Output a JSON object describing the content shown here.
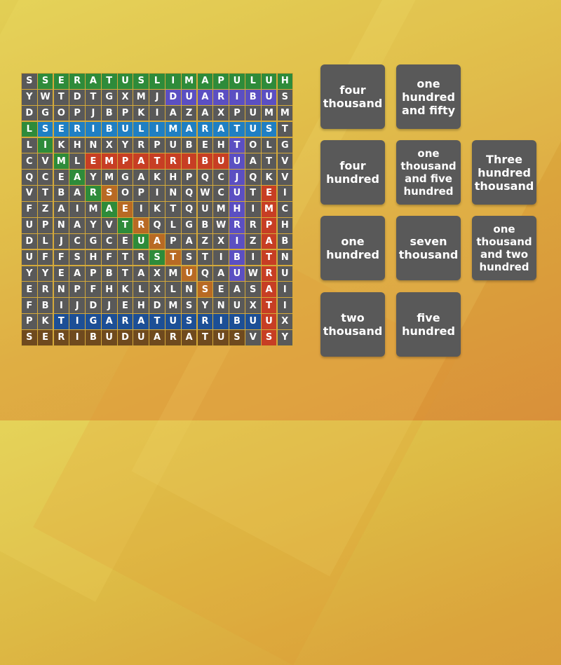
{
  "colors": {
    "cell_default": "#595959",
    "green": "#2e8b3a",
    "purple": "#5b4fc2",
    "blue": "#1f7fc3",
    "red": "#c73e24",
    "orange": "#b86a24",
    "navy": "#1c4f96",
    "brown": "#6f4a1e",
    "card": "#595959"
  },
  "grid": {
    "rows": [
      "SSERATUSLIMAPULUH",
      "YWTDTGXMJDUARIBUS",
      "DGOPJBPKIAZAXPUMM",
      "LSERIBULIMARATUST",
      "LIKHNXYRPUBEHTOLG",
      "CVMLEMPATRIBUUATV",
      "QCEAYMGAKHPQCJQKV",
      "VTBARSOPINQWCUTEI",
      "FZAIMAEIKTQUMHIMC",
      "UPNAYVTRQLGBWRRPH",
      "DLJCGCEUAPAZXIZAB",
      "UFFSHFTRSTSTIBITN",
      "YYEAPBTAXMUQAUWRU",
      "ERNPFHKLXLNSEASAI",
      "FBIJDJEHDMSYNUXTI",
      "PKTIGARATUSRIBUUX",
      "SERIBUDUARATUSVSY"
    ],
    "found_words": [
      {
        "word": "SERATUSLIMAPULUH",
        "color": "green",
        "cells": [
          [
            0,
            1
          ],
          [
            0,
            2
          ],
          [
            0,
            3
          ],
          [
            0,
            4
          ],
          [
            0,
            5
          ],
          [
            0,
            6
          ],
          [
            0,
            7
          ],
          [
            0,
            8
          ],
          [
            0,
            9
          ],
          [
            0,
            10
          ],
          [
            0,
            11
          ],
          [
            0,
            12
          ],
          [
            0,
            13
          ],
          [
            0,
            14
          ],
          [
            0,
            15
          ],
          [
            0,
            16
          ]
        ]
      },
      {
        "word": "DUARIBU",
        "color": "purple",
        "cells": [
          [
            1,
            9
          ],
          [
            1,
            10
          ],
          [
            1,
            11
          ],
          [
            1,
            12
          ],
          [
            1,
            13
          ],
          [
            1,
            14
          ],
          [
            1,
            15
          ]
        ]
      },
      {
        "word": "SERIBULIMARATUS",
        "color": "blue",
        "cells": [
          [
            3,
            1
          ],
          [
            3,
            2
          ],
          [
            3,
            3
          ],
          [
            3,
            4
          ],
          [
            3,
            5
          ],
          [
            3,
            6
          ],
          [
            3,
            7
          ],
          [
            3,
            8
          ],
          [
            3,
            9
          ],
          [
            3,
            10
          ],
          [
            3,
            11
          ],
          [
            3,
            12
          ],
          [
            3,
            13
          ],
          [
            3,
            14
          ],
          [
            3,
            15
          ]
        ]
      },
      {
        "word": "LIMARATUS",
        "color": "green",
        "cells": [
          [
            3,
            0
          ],
          [
            4,
            1
          ],
          [
            5,
            2
          ],
          [
            6,
            3
          ],
          [
            7,
            4
          ],
          [
            8,
            5
          ],
          [
            9,
            6
          ],
          [
            10,
            7
          ],
          [
            11,
            8
          ]
        ]
      },
      {
        "word": "TUJUHRIBU",
        "color": "purple",
        "cells": [
          [
            4,
            13
          ],
          [
            5,
            13
          ],
          [
            6,
            13
          ],
          [
            7,
            13
          ],
          [
            8,
            13
          ],
          [
            9,
            13
          ],
          [
            10,
            13
          ],
          [
            11,
            13
          ],
          [
            12,
            13
          ]
        ]
      },
      {
        "word": "EMPATRIBU",
        "color": "red",
        "cells": [
          [
            5,
            4
          ],
          [
            5,
            5
          ],
          [
            5,
            6
          ],
          [
            5,
            7
          ],
          [
            5,
            8
          ],
          [
            5,
            9
          ],
          [
            5,
            10
          ],
          [
            5,
            11
          ],
          [
            5,
            12
          ]
        ]
      },
      {
        "word": "SERATUS",
        "color": "orange",
        "cells": [
          [
            7,
            5
          ],
          [
            8,
            6
          ],
          [
            9,
            7
          ],
          [
            10,
            8
          ],
          [
            11,
            9
          ],
          [
            12,
            10
          ],
          [
            13,
            11
          ]
        ]
      },
      {
        "word": "EMPATRATUS",
        "color": "red",
        "cells": [
          [
            7,
            15
          ],
          [
            8,
            15
          ],
          [
            9,
            15
          ],
          [
            10,
            15
          ],
          [
            11,
            15
          ],
          [
            12,
            15
          ],
          [
            13,
            15
          ],
          [
            14,
            15
          ],
          [
            15,
            15
          ],
          [
            16,
            15
          ]
        ]
      },
      {
        "word": "TIGARATUSRIBU",
        "color": "navy",
        "cells": [
          [
            15,
            2
          ],
          [
            15,
            3
          ],
          [
            15,
            4
          ],
          [
            15,
            5
          ],
          [
            15,
            6
          ],
          [
            15,
            7
          ],
          [
            15,
            8
          ],
          [
            15,
            9
          ],
          [
            15,
            10
          ],
          [
            15,
            11
          ],
          [
            15,
            12
          ],
          [
            15,
            13
          ],
          [
            15,
            14
          ]
        ]
      },
      {
        "word": "SERIBUDUARATUS",
        "color": "brown",
        "cells": [
          [
            16,
            0
          ],
          [
            16,
            1
          ],
          [
            16,
            2
          ],
          [
            16,
            3
          ],
          [
            16,
            4
          ],
          [
            16,
            5
          ],
          [
            16,
            6
          ],
          [
            16,
            7
          ],
          [
            16,
            8
          ],
          [
            16,
            9
          ],
          [
            16,
            10
          ],
          [
            16,
            11
          ],
          [
            16,
            12
          ],
          [
            16,
            13
          ]
        ]
      }
    ]
  },
  "cards": [
    {
      "label": "four thousand"
    },
    {
      "label": "one hundred and fifty"
    },
    {
      "label": "four hundred"
    },
    {
      "label": "one thousand and five hundred"
    },
    {
      "label": "Three hundred thousand"
    },
    {
      "label": "one hundred"
    },
    {
      "label": "seven thousand"
    },
    {
      "label": "one thousand and two hundred"
    },
    {
      "label": "two thousand"
    },
    {
      "label": "five hundred"
    }
  ]
}
